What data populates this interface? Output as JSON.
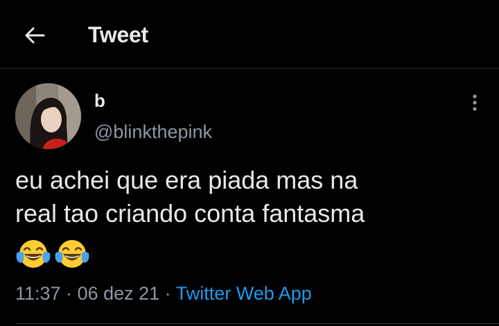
{
  "header": {
    "title": "Tweet",
    "back_icon": "arrow-left-icon"
  },
  "author": {
    "display_name": "b",
    "handle": "@blinkthepink",
    "avatar": "profile-photo"
  },
  "tweet": {
    "text_lines": [
      "eu achei que era piada mas na",
      "real tao criando conta fantasma"
    ],
    "emojis": [
      "face-with-tears-of-joy",
      "face-with-tears-of-joy"
    ]
  },
  "meta": {
    "time": "11:37",
    "separator": " · ",
    "date": "06 dez 21",
    "source": "Twitter Web App"
  },
  "colors": {
    "background": "#000000",
    "text": "#e7e9ea",
    "secondary": "#8b98a5",
    "accent": "#1d9bf0",
    "divider": "#2f3336"
  },
  "more_icon": "more-vertical-icon"
}
